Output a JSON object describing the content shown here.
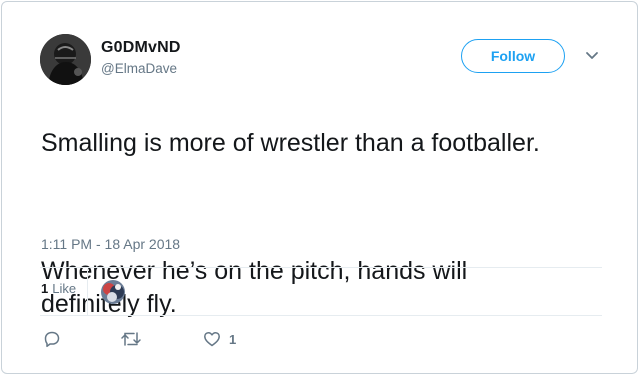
{
  "author": {
    "display_name": "G0DMvND",
    "handle": "@ElmaDave"
  },
  "follow_label": "Follow",
  "tweet": {
    "paragraphs": [
      "Smalling is more of wrestler than a footballer.",
      "Whenever he’s on the pitch, hands will definitely fly."
    ],
    "timestamp": "1:11 PM - 18 Apr 2018"
  },
  "likes": {
    "count": "1",
    "label": "Like"
  },
  "actions": {
    "reply_icon": "reply-icon",
    "retweet_icon": "retweet-icon",
    "like_icon": "heart-icon",
    "like_count": "1"
  },
  "colors": {
    "accent": "#1da1f2",
    "text": "#14171a",
    "secondary": "#657786",
    "border": "#e6ecf0"
  }
}
